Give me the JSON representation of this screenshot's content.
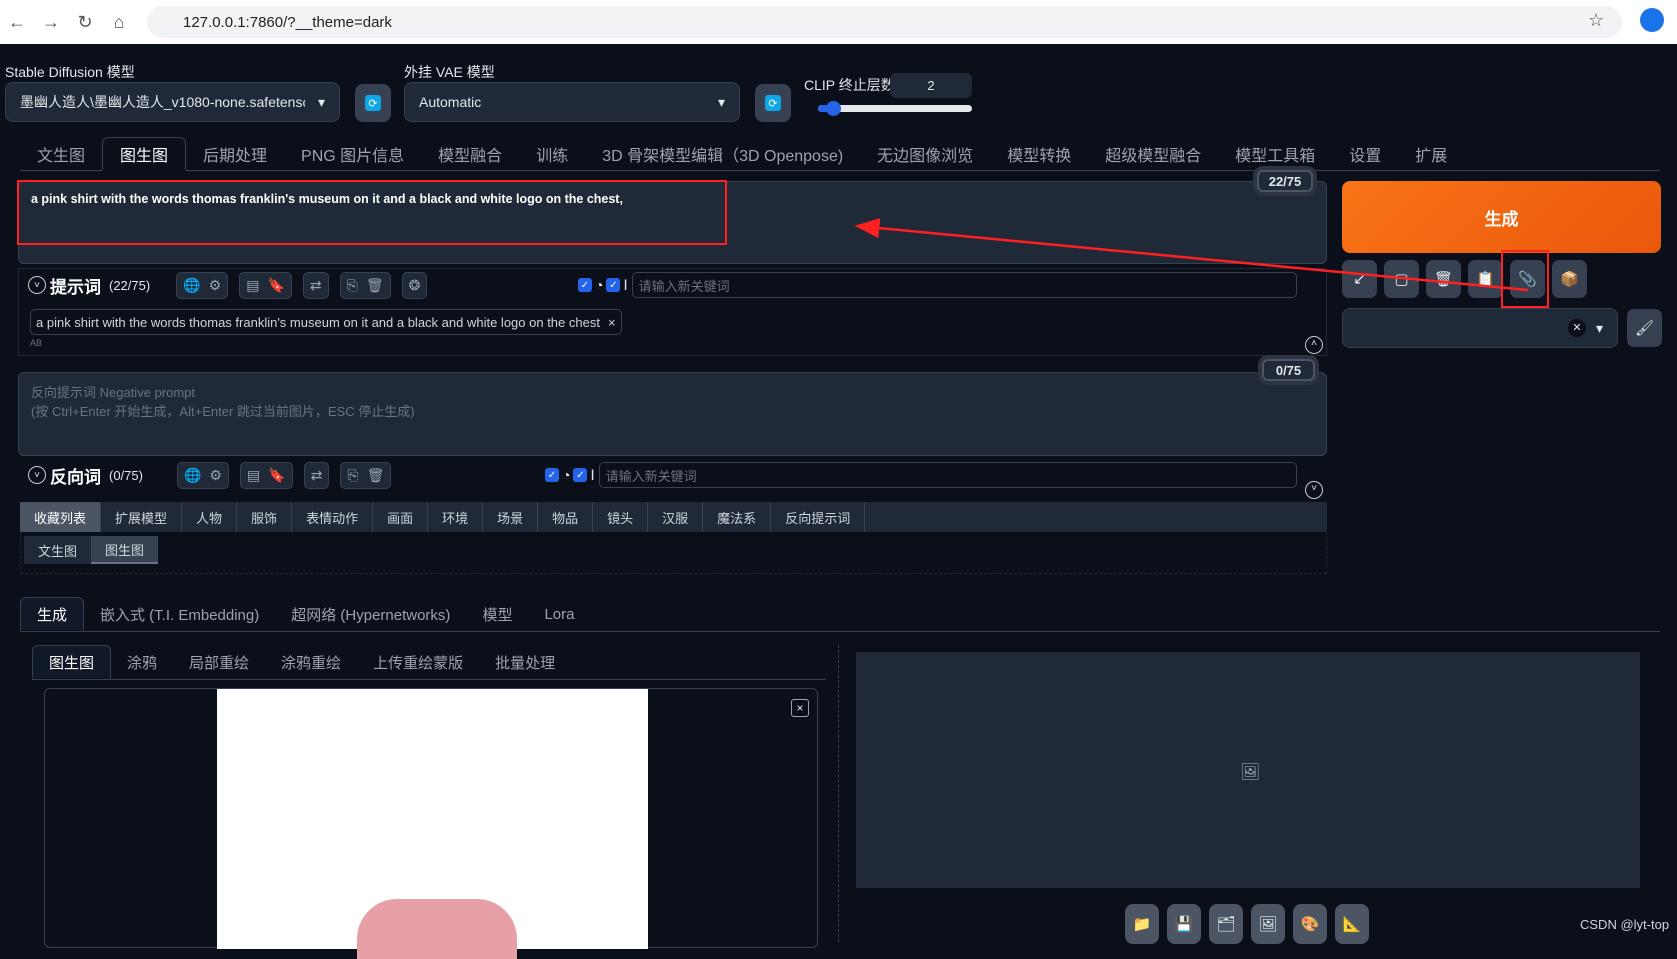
{
  "browser": {
    "url": "127.0.0.1:7860/?__theme=dark"
  },
  "top": {
    "sd_label": "Stable Diffusion 模型",
    "sd_value": "墨幽人造人\\墨幽人造人_v1080-none.safetensc",
    "vae_label": "外挂 VAE 模型",
    "vae_value": "Automatic",
    "clip_label": "CLIP 终止层数",
    "clip_value": "2",
    "clip_fraction": 0.1
  },
  "tabs": [
    "文生图",
    "图生图",
    "后期处理",
    "PNG 图片信息",
    "模型融合",
    "训练",
    "3D 骨架模型编辑（3D Openpose)",
    "无边图像浏览",
    "模型转换",
    "超级模型融合",
    "模型工具箱",
    "设置",
    "扩展"
  ],
  "prompt": {
    "text": "a pink shirt with the words thomas franklin's museum on it and a black and white logo on the chest,",
    "counter": "22/75",
    "section_label": "提示词",
    "section_count": "(22/75)",
    "keyword_placeholder": "请输入新关键词",
    "tag": "a pink shirt with the words thomas franklin's museum on it and a black and white logo on the chest"
  },
  "negative": {
    "placeholder": "反向提示词 Negative prompt\n(按 Ctrl+Enter 开始生成，Alt+Enter 跳过当前图片，ESC 停止生成)",
    "counter": "0/75",
    "section_label": "反向词",
    "section_count": "(0/75)",
    "keyword_placeholder": "请输入新关键词"
  },
  "generate_label": "生成",
  "categories": [
    "收藏列表",
    "扩展模型",
    "人物",
    "服饰",
    "表情动作",
    "画面",
    "环境",
    "场景",
    "物品",
    "镜头",
    "汉服",
    "魔法系",
    "反向提示词"
  ],
  "subcategories": [
    "文生图",
    "图生图"
  ],
  "panel_tabs": [
    "生成",
    "嵌入式 (T.I. Embedding)",
    "超网络 (Hypernetworks)",
    "模型",
    "Lora"
  ],
  "inner_tabs": [
    "图生图",
    "涂鸦",
    "局部重绘",
    "涂鸦重绘",
    "上传重绘蒙版",
    "批量处理"
  ],
  "watermark": "CSDN @lyt-top",
  "colors": {
    "accent": "#f97316",
    "annotation": "#ff2020"
  }
}
